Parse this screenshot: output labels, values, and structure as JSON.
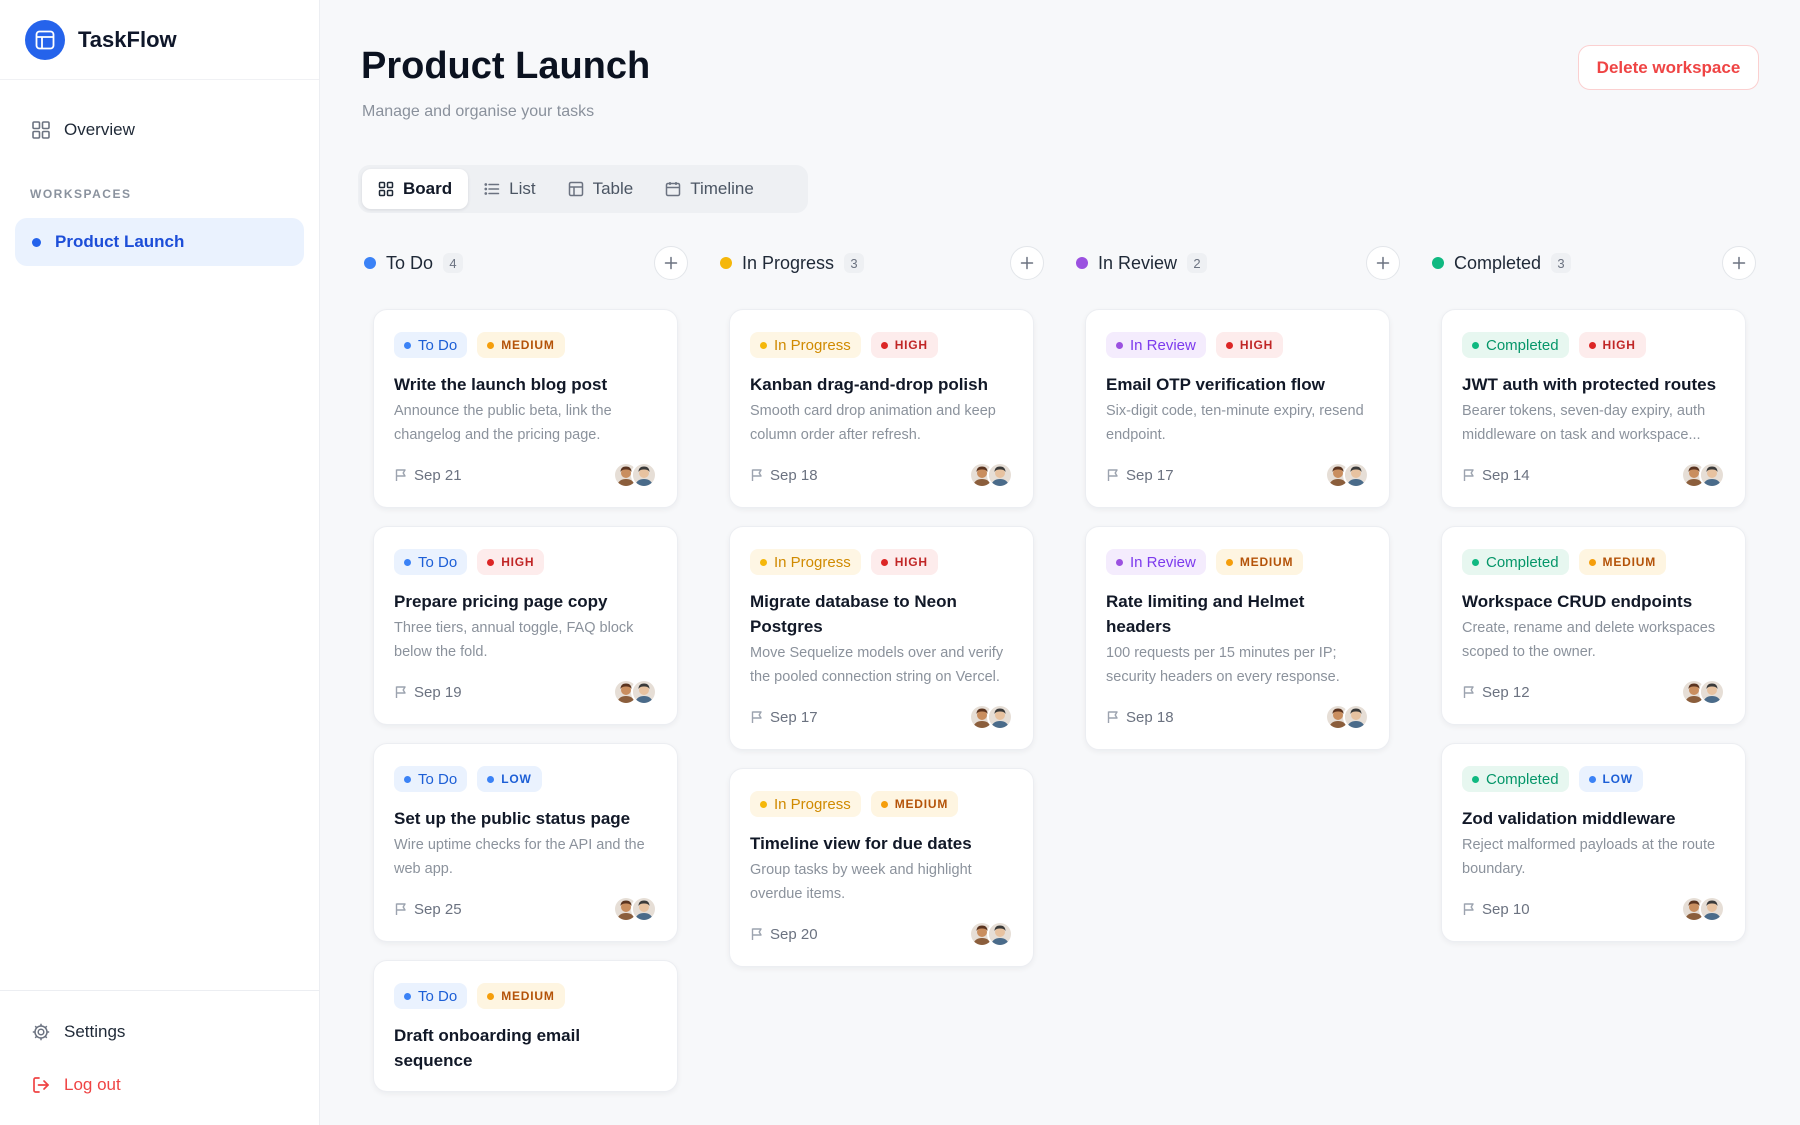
{
  "app": {
    "name": "TaskFlow"
  },
  "sidebar": {
    "overview_label": "Overview",
    "section_label": "WORKSPACES",
    "workspaces": [
      {
        "label": "Product Launch",
        "active": true
      }
    ],
    "settings_label": "Settings",
    "logout_label": "Log out"
  },
  "header": {
    "title": "Product Launch",
    "subtitle": "Manage and organise your tasks",
    "delete_label": "Delete workspace"
  },
  "view_tabs": [
    {
      "label": "Board",
      "icon": "grid-icon",
      "active": true
    },
    {
      "label": "List",
      "icon": "list-icon",
      "active": false
    },
    {
      "label": "Table",
      "icon": "table-icon",
      "active": false
    },
    {
      "label": "Timeline",
      "icon": "calendar-icon",
      "active": false
    }
  ],
  "colors": {
    "accent": "#2563eb",
    "danger": "#ef4444",
    "todo": "#3b82f6",
    "in_progress": "#f5b70a",
    "in_review": "#9b51e0",
    "completed": "#10b981",
    "priority_high": "#dc2626",
    "priority_medium": "#f59e0b",
    "priority_low": "#3b82f6"
  },
  "columns": [
    {
      "title": "To Do",
      "count": "4",
      "cards": [
        {
          "status": "To Do",
          "priority": "MEDIUM",
          "title": "Write the launch blog post",
          "description": "Announce the public beta, link the changelog and the pricing page.",
          "due": "Sep 21"
        },
        {
          "status": "To Do",
          "priority": "HIGH",
          "title": "Prepare pricing page copy",
          "description": "Three tiers, annual toggle, FAQ block below the fold.",
          "due": "Sep 19"
        },
        {
          "status": "To Do",
          "priority": "LOW",
          "title": "Set up the public status page",
          "description": "Wire uptime checks for the API and the web app.",
          "due": "Sep 25"
        },
        {
          "status": "To Do",
          "priority": "MEDIUM",
          "title": "Draft onboarding email sequence",
          "description": "",
          "due": ""
        }
      ]
    },
    {
      "title": "In Progress",
      "count": "3",
      "cards": [
        {
          "status": "In Progress",
          "priority": "HIGH",
          "title": "Kanban drag-and-drop polish",
          "description": "Smooth card drop animation and keep column order after refresh.",
          "due": "Sep 18"
        },
        {
          "status": "In Progress",
          "priority": "HIGH",
          "title": "Migrate database to Neon Postgres",
          "description": "Move Sequelize models over and verify the pooled connection string on Vercel.",
          "due": "Sep 17"
        },
        {
          "status": "In Progress",
          "priority": "MEDIUM",
          "title": "Timeline view for due dates",
          "description": "Group tasks by week and highlight overdue items.",
          "due": "Sep 20"
        }
      ]
    },
    {
      "title": "In Review",
      "count": "2",
      "cards": [
        {
          "status": "In Review",
          "priority": "HIGH",
          "title": "Email OTP verification flow",
          "description": "Six-digit code, ten-minute expiry, resend endpoint.",
          "due": "Sep 17"
        },
        {
          "status": "In Review",
          "priority": "MEDIUM",
          "title": "Rate limiting and Helmet headers",
          "description": "100 requests per 15 minutes per IP; security headers on every response.",
          "due": "Sep 18"
        }
      ]
    },
    {
      "title": "Completed",
      "count": "3",
      "cards": [
        {
          "status": "Completed",
          "priority": "HIGH",
          "title": "JWT auth with protected routes",
          "description": "Bearer tokens, seven-day expiry, auth middleware on task and workspace...",
          "due": "Sep 14"
        },
        {
          "status": "Completed",
          "priority": "MEDIUM",
          "title": "Workspace CRUD endpoints",
          "description": "Create, rename and delete workspaces scoped to the owner.",
          "due": "Sep 12"
        },
        {
          "status": "Completed",
          "priority": "LOW",
          "title": "Zod validation middleware",
          "description": "Reject malformed payloads at the route boundary.",
          "due": "Sep 10"
        }
      ]
    }
  ]
}
